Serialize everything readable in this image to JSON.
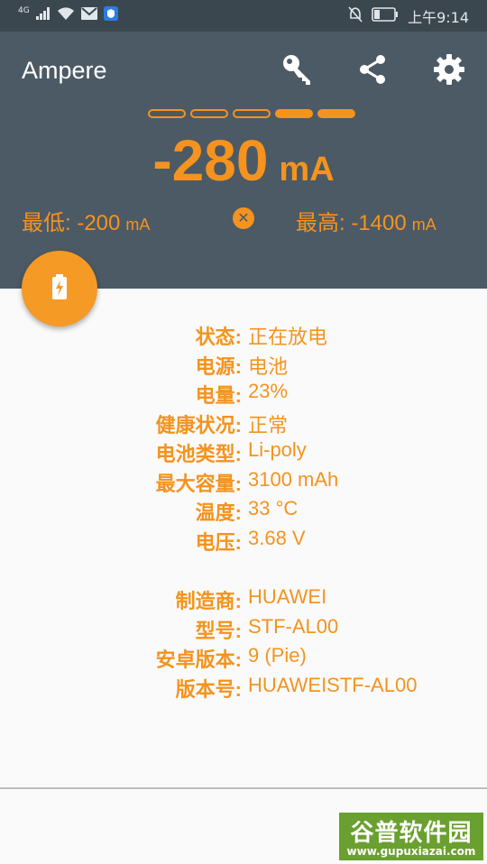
{
  "status_bar": {
    "network": "4G",
    "time": "上午9:14",
    "icons": [
      "signal-icon",
      "wifi-icon",
      "mail-icon",
      "shield-icon",
      "mute-icon",
      "battery-icon"
    ]
  },
  "toolbar": {
    "title": "Ampere",
    "icons": [
      "key-icon",
      "share-icon",
      "settings-icon"
    ]
  },
  "meter": {
    "level_indicators": 5,
    "active_indicators": 2,
    "current_value": "-280",
    "current_unit": "mA",
    "min_label": "最低: -200",
    "min_unit": "mA",
    "max_label": "最高: -1400",
    "max_unit": "mA",
    "clear_icon": "close-circle-icon"
  },
  "fab": {
    "icon": "battery-charging-icon"
  },
  "battery_info": [
    {
      "label": "状态:",
      "value": "正在放电"
    },
    {
      "label": "电源:",
      "value": "电池"
    },
    {
      "label": "电量:",
      "value": "23%"
    },
    {
      "label": "健康状况:",
      "value": "正常"
    },
    {
      "label": "电池类型:",
      "value": "Li-poly"
    },
    {
      "label": "最大容量:",
      "value": "3100 mAh"
    },
    {
      "label": "温度:",
      "value": "33 °C"
    },
    {
      "label": "电压:",
      "value": "3.68 V"
    }
  ],
  "device_info": [
    {
      "label": "制造商:",
      "value": "HUAWEI"
    },
    {
      "label": "型号:",
      "value": "STF-AL00"
    },
    {
      "label": "安卓版本:",
      "value": "9 (Pie)"
    },
    {
      "label": "版本号:",
      "value": "HUAWEISTF-AL00"
    }
  ],
  "watermark": {
    "brand": "谷普软件园",
    "url": "www.gupuxiazai.com"
  },
  "colors": {
    "accent": "#f5931e",
    "appbar": "#4c5a65",
    "statusbar": "#3b474f",
    "background": "#fafafa"
  }
}
